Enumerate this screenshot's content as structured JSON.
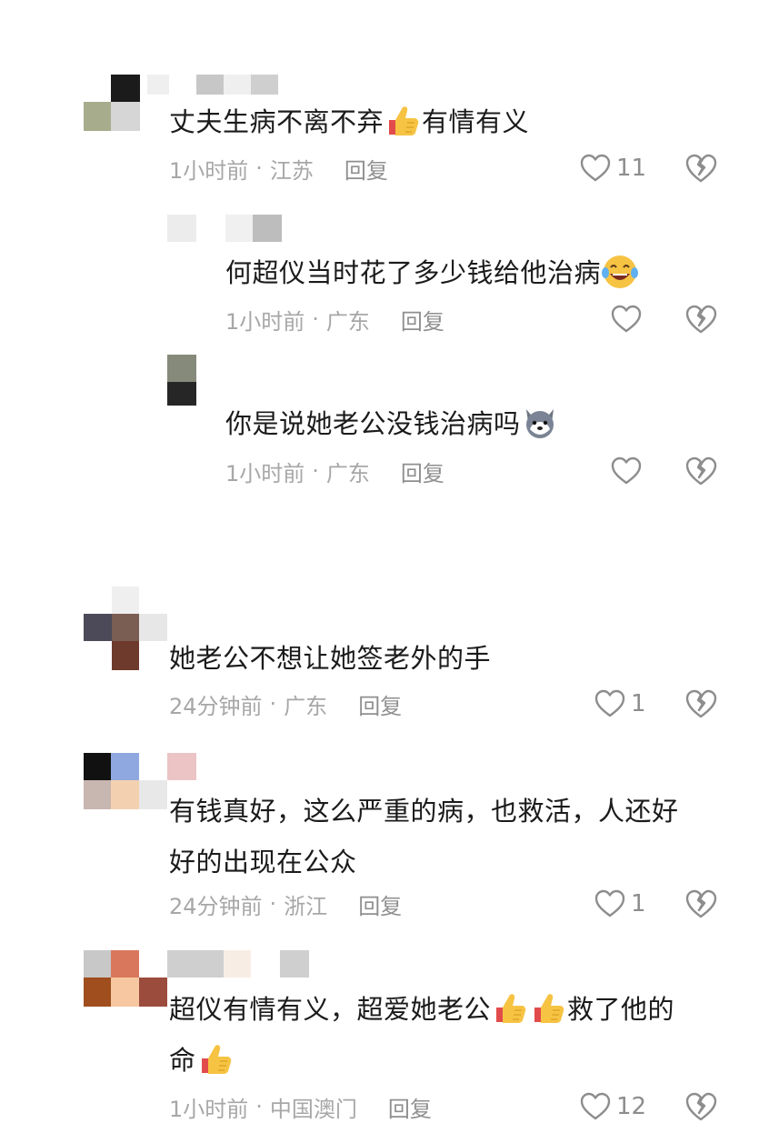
{
  "comments": [
    {
      "text_lines": [
        "丈夫生病不离不弃",
        "有情有义"
      ],
      "time": "1小时前",
      "location": "江苏",
      "reply_label": "回复",
      "likes": "11",
      "emoji_after_first": "thumbs-up"
    },
    {
      "text_lines": [
        "何超仪当时花了多少钱给他治病"
      ],
      "time": "1小时前",
      "location": "广东",
      "reply_label": "回复",
      "likes": "",
      "emoji_after_first": "laughing-tears"
    },
    {
      "text_lines": [
        "你是说她老公没钱治病吗"
      ],
      "time": "1小时前",
      "location": "广东",
      "reply_label": "回复",
      "likes": "",
      "emoji_after_first": "husky"
    },
    {
      "text_lines": [
        "她老公不想让她签老外的手"
      ],
      "time": "24分钟前",
      "location": "广东",
      "reply_label": "回复",
      "likes": "1"
    },
    {
      "text_lines": [
        "有钱真好，这么严重的病，也救活，人还好",
        "好的出现在公众"
      ],
      "time": "24分钟前",
      "location": "浙江",
      "reply_label": "回复",
      "likes": "1"
    },
    {
      "text_lines": [
        "超仪有情有义，超爱她老公",
        "救了他的",
        "命"
      ],
      "time": "1小时前",
      "location": "中国澳门",
      "reply_label": "回复",
      "likes": "12"
    }
  ],
  "meta_separator": "·",
  "icons": {
    "like": "heart-outline-icon",
    "dislike": "broken-heart-icon",
    "thumbs_up": "thumbs-up-emoji",
    "laughing": "laughing-tears-emoji",
    "husky": "husky-emoji"
  },
  "colors": {
    "text": "#1b1b1b",
    "meta": "#a7a7a7",
    "icon": "#8d8d8d",
    "thumb": "#f6c343"
  }
}
